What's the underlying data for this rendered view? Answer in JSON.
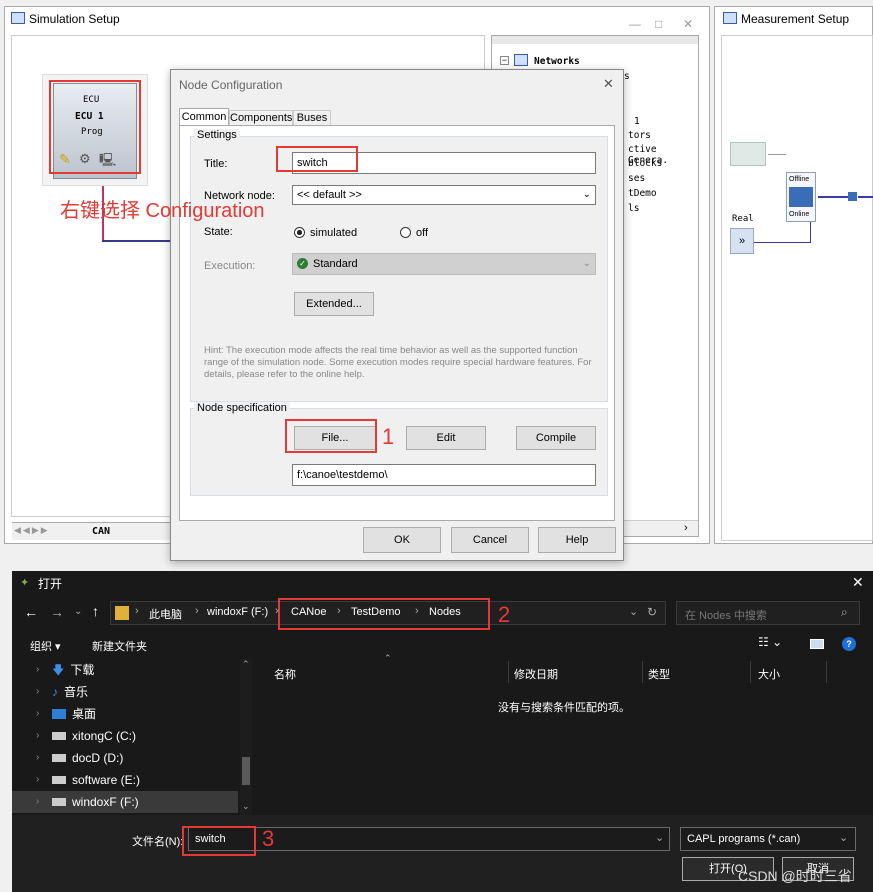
{
  "sim": {
    "title": "Simulation Setup",
    "ecu": {
      "line1": "ECU",
      "line2": "ECU 1",
      "line3": "Prog"
    },
    "annotation": "右键选择 Configuration",
    "tab": "CAN",
    "tree": [
      "Networks",
      "s",
      "1",
      "tors",
      "ctive Genera.",
      "blocks",
      "ses",
      "tDemo",
      "ls"
    ]
  },
  "meas": {
    "title": "Measurement Setup",
    "offline": "Offline",
    "online": "Online",
    "real": "Real",
    "real_btn": "»"
  },
  "dialog": {
    "title": "Node Configuration",
    "tabs": [
      "Common",
      "Components",
      "Buses"
    ],
    "settings_label": "Settings",
    "title_label": "Title:",
    "title_value": "switch",
    "network_label": "Network node:",
    "network_value": "<< default >>",
    "state_label": "State:",
    "state_simulated": "simulated",
    "state_off": "off",
    "exec_label": "Execution:",
    "exec_value": "Standard",
    "extended_btn": "Extended...",
    "hint": "Hint: The execution mode affects the real time behavior as well as the supported function range of the simulation node. Some execution modes require special hardware features. For details, please refer to the online help.",
    "nodespec_label": "Node specification",
    "file_btn": "File...",
    "edit_btn": "Edit",
    "compile_btn": "Compile",
    "path": "f:\\canoe\\testdemo\\",
    "ok": "OK",
    "cancel": "Cancel",
    "help": "Help",
    "num1": "1"
  },
  "open": {
    "title": "打开",
    "crumbs": [
      "此电脑",
      "windoxF (F:)",
      "CANoe",
      "TestDemo",
      "Nodes"
    ],
    "search_placeholder": "在 Nodes 中搜索",
    "organize": "组织 ▾",
    "new_folder": "新建文件夹",
    "nav": [
      "下载",
      "音乐",
      "桌面",
      "xitongC (C:)",
      "docD (D:)",
      "software (E:)",
      "windoxF (F:)"
    ],
    "cols": [
      "名称",
      "修改日期",
      "类型",
      "大小"
    ],
    "empty": "没有与搜索条件匹配的项。",
    "filename_label": "文件名(N):",
    "filename_value": "switch",
    "filetype": "CAPL programs (*.can)",
    "open_btn": "打开(O)",
    "cancel_btn": "取消",
    "num2": "2",
    "num3": "3"
  },
  "watermark": "CSDN @时时三省",
  "colors": {
    "red": "#e53935",
    "dark": "#1f1f1f",
    "blue": "#1e6fd9"
  }
}
